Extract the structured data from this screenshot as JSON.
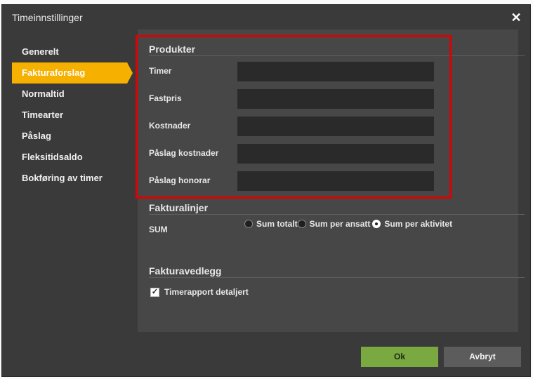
{
  "dialog": {
    "title": "Timeinnstillinger",
    "close_symbol": "✕"
  },
  "sidebar": {
    "items": [
      {
        "label": "Generelt",
        "active": false
      },
      {
        "label": "Fakturaforslag",
        "active": true
      },
      {
        "label": "Normaltid",
        "active": false
      },
      {
        "label": "Timearter",
        "active": false
      },
      {
        "label": "Påslag",
        "active": false
      },
      {
        "label": "Fleksitidsaldo",
        "active": false
      },
      {
        "label": "Bokføring av timer",
        "active": false
      }
    ]
  },
  "produkter": {
    "title": "Produkter",
    "fields": [
      {
        "label": "Timer",
        "value": ""
      },
      {
        "label": "Fastpris",
        "value": ""
      },
      {
        "label": "Kostnader",
        "value": ""
      },
      {
        "label": "Påslag kostnader",
        "value": ""
      },
      {
        "label": "Påslag honorar",
        "value": ""
      }
    ]
  },
  "fakturalinjer": {
    "title": "Fakturalinjer",
    "sum_label": "SUM",
    "options": [
      {
        "label": "Sum totalt",
        "checked": false
      },
      {
        "label": "Sum per ansatt",
        "checked": false
      },
      {
        "label": "Sum per aktivitet",
        "checked": true
      }
    ]
  },
  "fakturavedlegg": {
    "title": "Fakturavedlegg",
    "checkbox_label": "Timerapport detaljert",
    "checked": true,
    "check_symbol": "✓"
  },
  "buttons": {
    "ok_label": "Ok",
    "cancel_label": "Avbryt"
  },
  "colors": {
    "accent": "#f5b000",
    "ok": "#7aa941",
    "highlight": "#e00000"
  }
}
